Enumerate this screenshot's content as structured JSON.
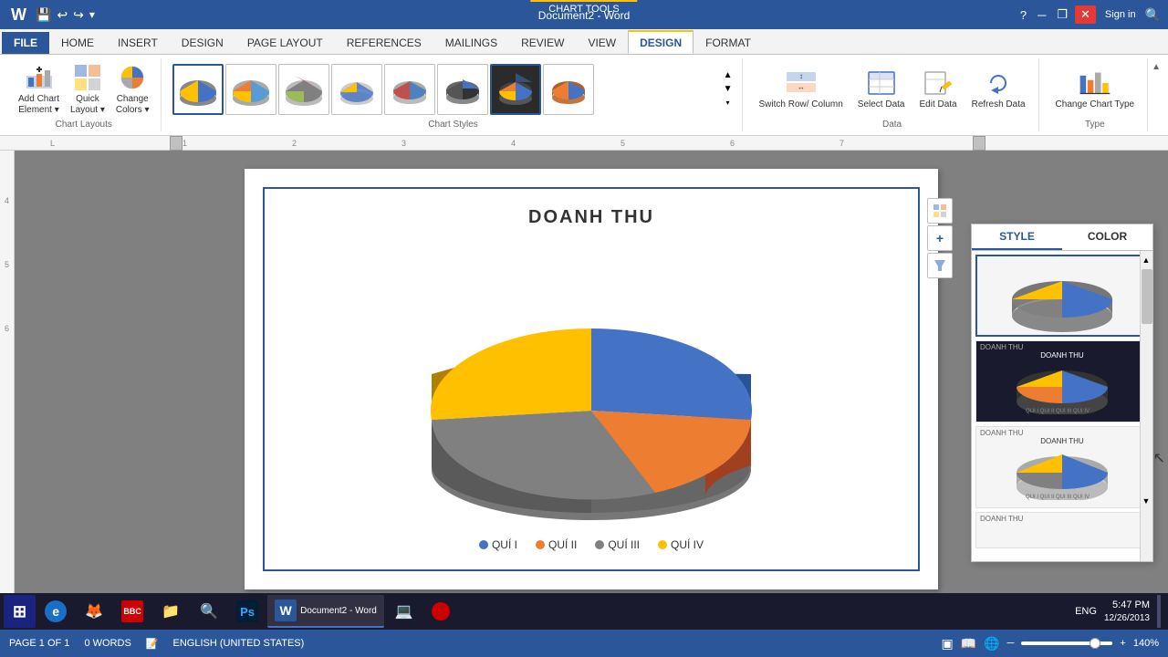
{
  "titlebar": {
    "docname": "Document2 - Word",
    "chart_tools": "CHART TOOLS",
    "close": "✕",
    "minimize": "─",
    "restore": "❐",
    "help": "?",
    "signin": "Sign in",
    "quickaccess": [
      "💾",
      "↩",
      "↪",
      "📎"
    ]
  },
  "ribbon": {
    "tabs": [
      "FILE",
      "HOME",
      "INSERT",
      "DESIGN",
      "PAGE LAYOUT",
      "REFERENCES",
      "MAILINGS",
      "REVIEW",
      "VIEW",
      "DESIGN",
      "FORMAT"
    ],
    "active_tab": "DESIGN",
    "chart_tools_label": "CHART TOOLS",
    "groups": {
      "chart_layouts": {
        "label": "Chart Layouts",
        "add_chart_element": "Add Chart\nElement",
        "quick_layout": "Quick\nLayout",
        "change_colors": "Change\nColors"
      },
      "chart_styles": {
        "label": "Chart Styles"
      },
      "data": {
        "label": "Data",
        "switch_row_col": "Switch Row/\nColumn",
        "select_data": "Select\nData",
        "edit_data": "Edit\nData",
        "refresh_data": "Refresh\nData"
      },
      "type": {
        "label": "Type",
        "change_chart_type": "Change\nChart Type"
      }
    }
  },
  "chart": {
    "title": "DOANH THU",
    "legend": [
      {
        "label": "QUÍ I",
        "color": "#4472c4"
      },
      {
        "label": "QUÍ II",
        "color": "#ed7d31"
      },
      {
        "label": "QUÍ III",
        "color": "#a9a9a9"
      },
      {
        "label": "QUÍ IV",
        "color": "#ffc000"
      }
    ],
    "segments": [
      {
        "label": "QUÍ I",
        "color": "#4472c4",
        "startAngle": 0,
        "endAngle": 80
      },
      {
        "label": "QUÍ II",
        "color": "#ed7d31",
        "startAngle": 80,
        "endAngle": 175
      },
      {
        "label": "QUÍ III",
        "color": "#808080",
        "startAngle": 175,
        "endAngle": 310
      },
      {
        "label": "QUÍ IV",
        "color": "#ffc000",
        "startAngle": 310,
        "endAngle": 360
      }
    ]
  },
  "style_panel": {
    "tabs": [
      "STYLE",
      "COLOR"
    ],
    "active_tab": "STYLE",
    "styles": [
      {
        "id": 1,
        "label": "",
        "active": true
      },
      {
        "id": 2,
        "label": "DOANH THU",
        "active": false,
        "dark": true
      },
      {
        "id": 3,
        "label": "DOANH THU",
        "active": false
      },
      {
        "id": 4,
        "label": "DOANH THU",
        "active": false
      }
    ]
  },
  "status_bar": {
    "page": "PAGE 1 OF 1",
    "words": "0 WORDS",
    "language": "ENGLISH (UNITED STATES)",
    "zoom": "140%"
  },
  "taskbar": {
    "time": "5:47 PM",
    "date": "12/26/2013",
    "language": "ENG",
    "apps": [
      {
        "icon": "🌐",
        "label": "IE"
      },
      {
        "icon": "🦊",
        "label": "Firefox"
      },
      {
        "icon": "📺",
        "label": "BBC"
      },
      {
        "icon": "📁",
        "label": "Explorer"
      },
      {
        "icon": "🔍",
        "label": "Chrome"
      },
      {
        "icon": "🎨",
        "label": "Photoshop"
      },
      {
        "icon": "W",
        "label": "Word",
        "active": true
      },
      {
        "icon": "💻",
        "label": "App"
      },
      {
        "icon": "⏺",
        "label": "Record"
      }
    ]
  }
}
